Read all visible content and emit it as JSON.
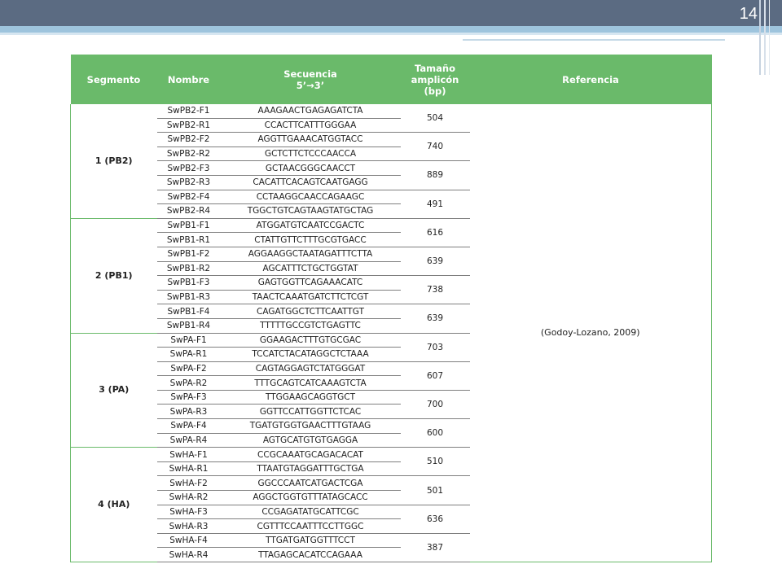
{
  "slide_number": "14",
  "headers": [
    "Segmento",
    "Nombre",
    "Secuencia\n5’→3’",
    "Tamaño\namplicón\n(bp)",
    "Referencia"
  ],
  "reference": "(Godoy-Lozano, 2009)",
  "segments": [
    {
      "label": "1 (PB2)",
      "pairs": [
        {
          "size": "504",
          "primers": [
            {
              "name": "SwPB2-F1",
              "seq": "AAAGAACTGAGAGATCTA"
            },
            {
              "name": "SwPB2-R1",
              "seq": "CCACTTCATTTGGGAA"
            }
          ]
        },
        {
          "size": "740",
          "primers": [
            {
              "name": "SwPB2-F2",
              "seq": "AGGTTGAAACATGGTACC"
            },
            {
              "name": "SwPB2-R2",
              "seq": "GCTCTTCTCCCAACCA"
            }
          ]
        },
        {
          "size": "889",
          "primers": [
            {
              "name": "SwPB2-F3",
              "seq": "GCTAACGGGCAACCT"
            },
            {
              "name": "SwPB2-R3",
              "seq": "CACATTCACAGTCAATGAGG"
            }
          ]
        },
        {
          "size": "491",
          "primers": [
            {
              "name": "SwPB2-F4",
              "seq": "CCTAAGGCAACCAGAAGC"
            },
            {
              "name": "SwPB2-R4",
              "seq": "TGGCTGTCAGTAAGTATGCTAG"
            }
          ]
        }
      ]
    },
    {
      "label": "2 (PB1)",
      "pairs": [
        {
          "size": "616",
          "primers": [
            {
              "name": "SwPB1-F1",
              "seq": "ATGGATGTCAATCCGACTC"
            },
            {
              "name": "SwPB1-R1",
              "seq": "CTATTGTTCTTTGCGTGACC"
            }
          ]
        },
        {
          "size": "639",
          "primers": [
            {
              "name": "SwPB1-F2",
              "seq": "AGGAAGGCTAATAGATTTCTTA"
            },
            {
              "name": "SwPB1-R2",
              "seq": "AGCATTTCTGCTGGTAT"
            }
          ]
        },
        {
          "size": "738",
          "primers": [
            {
              "name": "SwPB1-F3",
              "seq": "GAGTGGTTCAGAAACATC"
            },
            {
              "name": "SwPB1-R3",
              "seq": "TAACTCAAATGATCTTCTCGT"
            }
          ]
        },
        {
          "size": "639",
          "primers": [
            {
              "name": "SwPB1-F4",
              "seq": "CAGATGGCTCTTCAATTGT"
            },
            {
              "name": "SwPB1-R4",
              "seq": "TTTTTGCCGTCTGAGTTC"
            }
          ]
        }
      ]
    },
    {
      "label": "3 (PA)",
      "pairs": [
        {
          "size": "703",
          "primers": [
            {
              "name": "SwPA-F1",
              "seq": "GGAAGACTTTGTGCGAC"
            },
            {
              "name": "SwPA-R1",
              "seq": "TCCATCTACATAGGCTCTAAA"
            }
          ]
        },
        {
          "size": "607",
          "primers": [
            {
              "name": "SwPA-F2",
              "seq": "CAGTAGGAGTCTATGGGAT"
            },
            {
              "name": "SwPA-R2",
              "seq": "TTTGCAGTCATCAAAGTCTA"
            }
          ]
        },
        {
          "size": "700",
          "primers": [
            {
              "name": "SwPA-F3",
              "seq": "TTGGAAGCAGGTGCT"
            },
            {
              "name": "SwPA-R3",
              "seq": "GGTTCCATTGGTTCTCAC"
            }
          ]
        },
        {
          "size": "600",
          "primers": [
            {
              "name": "SwPA-F4",
              "seq": "TGATGTGGTGAACTTTGTAAG"
            },
            {
              "name": "SwPA-R4",
              "seq": "AGTGCATGTGTGAGGA"
            }
          ]
        }
      ]
    },
    {
      "label": "4 (HA)",
      "pairs": [
        {
          "size": "510",
          "primers": [
            {
              "name": "SwHA-F1",
              "seq": "CCGCAAATGCAGACACAT"
            },
            {
              "name": "SwHA-R1",
              "seq": "TTAATGTAGGATTTGCTGA"
            }
          ]
        },
        {
          "size": "501",
          "primers": [
            {
              "name": "SwHA-F2",
              "seq": "GGCCCAATCATGACTCGA"
            },
            {
              "name": "SwHA-R2",
              "seq": "AGGCTGGTGTTTATAGCACC"
            }
          ]
        },
        {
          "size": "636",
          "primers": [
            {
              "name": "SwHA-F3",
              "seq": "CCGAGATATGCATTCGC"
            },
            {
              "name": "SwHA-R3",
              "seq": "CGTTTCCAATTTCCTTGGC"
            }
          ]
        },
        {
          "size": "387",
          "primers": [
            {
              "name": "SwHA-F4",
              "seq": "TTGATGATGGTTTCCT"
            },
            {
              "name": "SwHA-R4",
              "seq": "TTAGAGCACATCCAGAAA"
            }
          ]
        }
      ]
    }
  ]
}
